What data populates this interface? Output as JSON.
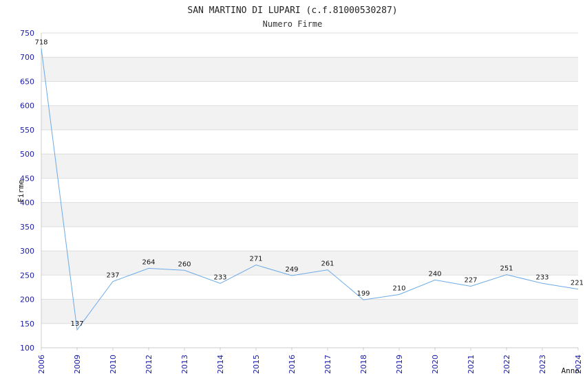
{
  "chart_data": {
    "type": "line",
    "title": "SAN MARTINO DI LUPARI (c.f.81000530287)",
    "subtitle": "Numero Firme",
    "xlabel": "Anno",
    "ylabel": "Firme",
    "x": [
      "2006",
      "2009",
      "2010",
      "2012",
      "2013",
      "2014",
      "2015",
      "2016",
      "2017",
      "2018",
      "2019",
      "2020",
      "2021",
      "2022",
      "2023",
      "2024"
    ],
    "values": [
      718,
      137,
      237,
      264,
      260,
      233,
      271,
      249,
      261,
      199,
      210,
      240,
      227,
      251,
      233,
      221
    ],
    "ylim": [
      100,
      750
    ],
    "yticks": [
      100,
      150,
      200,
      250,
      300,
      350,
      400,
      450,
      500,
      550,
      600,
      650,
      700,
      750
    ],
    "grid": true,
    "colors": {
      "line": "#6aaae8",
      "band": "#f2f2f2",
      "tick_text": "#1a1aa6"
    }
  }
}
